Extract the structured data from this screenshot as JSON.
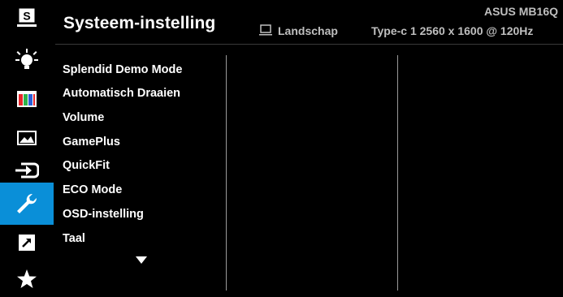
{
  "header": {
    "title": "Systeem-instelling",
    "model": "ASUS MB16Q",
    "orientation_icon": "monitor-icon",
    "orientation": "Landschap",
    "signal": "Type-c 1  2560 x 1600 @ 120Hz"
  },
  "sidebar": {
    "items": [
      {
        "icon": "splendid-s-icon"
      },
      {
        "icon": "blue-light-bulb-icon"
      },
      {
        "icon": "color-bars-icon"
      },
      {
        "icon": "image-icon"
      },
      {
        "icon": "input-select-icon"
      },
      {
        "icon": "wrench-icon",
        "active": true
      },
      {
        "icon": "shortcut-arrow-icon"
      },
      {
        "icon": "star-icon"
      }
    ]
  },
  "menu": {
    "items": [
      "Splendid Demo Mode",
      "Automatisch Draaien",
      "Volume",
      "GamePlus",
      "QuickFit",
      "ECO Mode",
      "OSD-instelling",
      "Taal"
    ],
    "more_icon": "triangle-down-icon"
  },
  "colors": {
    "accent": "#0a8fd8",
    "background": "#000000",
    "text": "#ffffff",
    "secondary_text": "#bfbfbf"
  }
}
